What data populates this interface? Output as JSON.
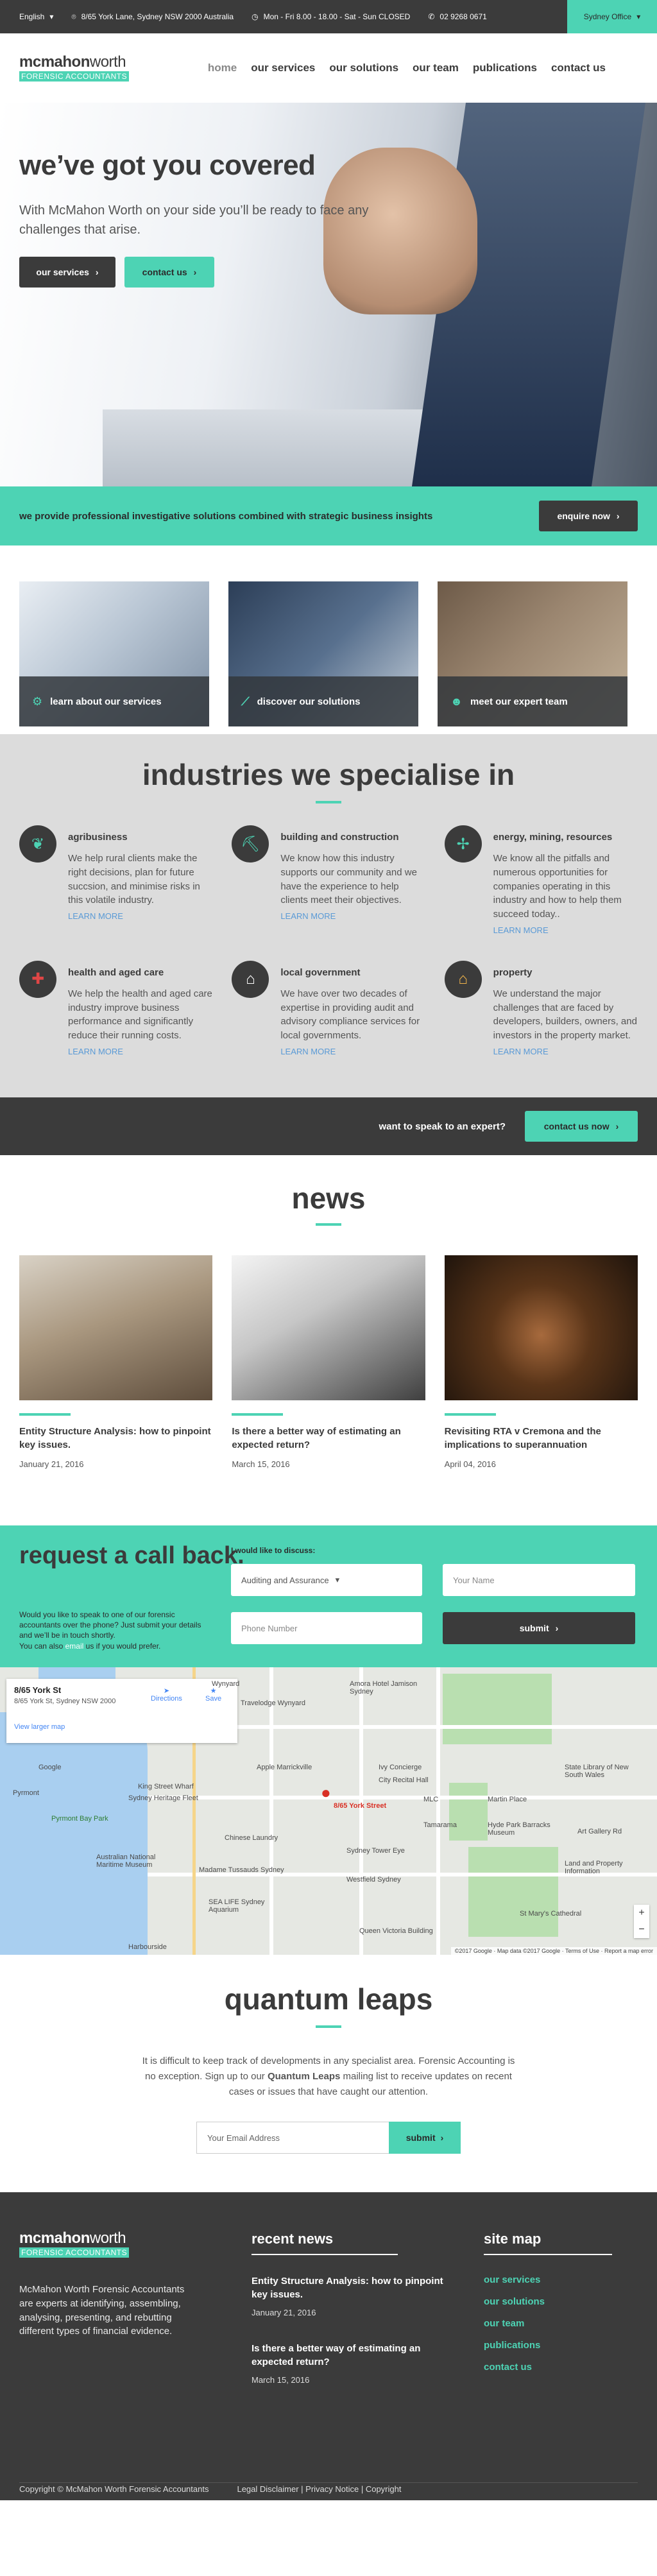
{
  "topbar": {
    "language": "English",
    "address": "8/65 York Lane, Sydney NSW 2000 Australia",
    "hours": "Mon - Fri 8.00 - 18.00 - Sat - Sun CLOSED",
    "phone": "02 9268 0671",
    "office": "Sydney Office"
  },
  "logo": {
    "name_bold": "mcmahon",
    "name_light": "worth",
    "tagline": "FORENSIC ACCOUNTANTS"
  },
  "nav": [
    "home",
    "our services",
    "our solutions",
    "our team",
    "publications",
    "contact us"
  ],
  "hero": {
    "title": "we’ve got you covered",
    "text": "With McMahon Worth on your side you’ll be ready to face any challenges that arise.",
    "btn_services": "our services",
    "btn_contact": "contact us"
  },
  "band": {
    "text": "we provide professional investigative solutions combined with strategic business insights",
    "button": "enquire now"
  },
  "tiles": [
    {
      "label": "learn about our services",
      "icon": "gears-icon"
    },
    {
      "label": "discover our solutions",
      "icon": "chart-icon"
    },
    {
      "label": "meet our expert team",
      "icon": "team-icon"
    }
  ],
  "industries": {
    "title": "industries we specialise in",
    "more": "LEARN MORE",
    "items": [
      {
        "title": "agribusiness",
        "text": "We help rural clients make the right decisions, plan for future succsion, and minimise risks in this volatile industry."
      },
      {
        "title": "building and construction",
        "text": "We know how this industry supports our community and we have the experience to help clients meet their objectives."
      },
      {
        "title": "energy, mining, resources",
        "text": "We know all the pitfalls and numerous opportunities for companies operating in this industry and how to help them succeed today.."
      },
      {
        "title": "health and aged care",
        "text": "We help the health and aged care industry improve business performance and significantly reduce their running costs."
      },
      {
        "title": "local government",
        "text": "We have over two decades of expertise in providing audit and advisory compliance services for local governments."
      },
      {
        "title": "property",
        "text": "We understand the major challenges that are faced by developers, builders, owners, and investors in the property market."
      }
    ]
  },
  "expert": {
    "question": "want to speak to an expert?",
    "button": "contact us now"
  },
  "news": {
    "title": "news",
    "items": [
      {
        "title": "Entity Structure Analysis: how to pinpoint key issues.",
        "date": "January 21, 2016"
      },
      {
        "title": "Is there a better way of estimating an expected return?",
        "date": "March 15, 2016"
      },
      {
        "title": "Revisiting RTA v Cremona and the implications to superannuation",
        "date": "April 04, 2016"
      }
    ]
  },
  "callback": {
    "title": "request a call back.",
    "desc_1": "Would you like to speak to one of our forensic accountants over the phone? Just submit your details and we’ll be in touch shortly.",
    "desc_2a": "You can also",
    "desc_email": "email",
    "desc_2b": "us if you would prefer.",
    "discuss_label": "I would like to discuss:",
    "select_value": "Auditing and Assurance",
    "name_placeholder": "Your Name",
    "phone_placeholder": "Phone Number",
    "submit": "submit"
  },
  "map": {
    "place_title": "8/65 York St",
    "place_address": "8/65 York St, Sydney NSW 2000",
    "directions": "Directions",
    "save": "Save",
    "larger": "View larger map",
    "pin_label": "8/65 York Street",
    "labels": [
      "Wynyard",
      "Travelodge Wynyard",
      "Amora Hotel Jamison Sydney",
      "Google",
      "Pyrmont",
      "Pyrmont Bay Park",
      "King Street Wharf",
      "Sydney Heritage Fleet",
      "Apple Marrickville",
      "Ivy Concierge",
      "City Recital Hall",
      "State Library of New South Wales",
      "Martin Place",
      "Chinese Laundry",
      "Hyde Park Barracks Museum",
      "Sydney Tower Eye",
      "Westfield Sydney",
      "SEA LIFE Sydney Aquarium",
      "Madame Tussauds Sydney",
      "Australian National Maritime Museum",
      "Tamarama",
      "MLC",
      "Land and Property Information",
      "St Mary's Cathedral",
      "Queen Victoria Building",
      "Harbourside",
      "Art Gallery Rd"
    ],
    "copyright": "©2017 Google · Map data ©2017 Google · Terms of Use · Report a map error"
  },
  "quantum": {
    "title": "quantum leaps",
    "text_1": "It is difficult to keep track of developments in any specialist area. Forensic Accounting is no exception. Sign up to our",
    "text_bold": "Quantum Leaps",
    "text_2": "mailing list to receive updates on recent cases or issues that have caught our attention.",
    "email_placeholder": "Your Email Address",
    "submit": "submit"
  },
  "footer": {
    "about": "McMahon Worth Forensic Accountants are experts at identifying, assembling, analysing, presenting, and rebutting different types of financial evidence.",
    "recent_title": "recent news",
    "recent": [
      {
        "title": "Entity Structure Analysis: how to pinpoint key issues.",
        "date": "January 21, 2016"
      },
      {
        "title": "Is there a better way of estimating an expected return?",
        "date": "March 15, 2016"
      }
    ],
    "sitemap_title": "site map",
    "sitemap": [
      "our services",
      "our solutions",
      "our team",
      "publications",
      "contact us"
    ],
    "copyright": "Copyright © McMahon Worth Forensic Accountants",
    "legal": "Legal Disclaimer | Privacy Notice | Copyright"
  },
  "colors": {
    "accent": "#4dd3b4",
    "dark": "#3b3b3b",
    "light_grey": "#dcdcdc"
  }
}
